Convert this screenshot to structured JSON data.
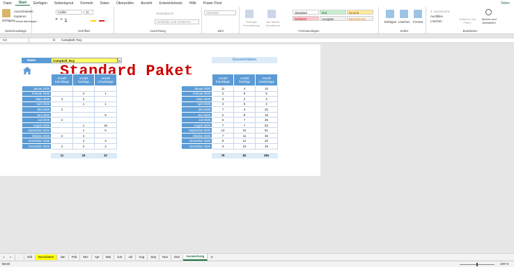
{
  "menu": {
    "tabs": [
      "Datei",
      "Start",
      "Einfügen",
      "Seitenlayout",
      "Formeln",
      "Daten",
      "Überprüfen",
      "Ansicht",
      "Entwicklertools",
      "Hilfe",
      "Power Pivot"
    ],
    "share": "Teilen"
  },
  "ribbon": {
    "clipboard": {
      "paste": "Einfügen",
      "cut": "Ausschneiden",
      "copy": "Kopieren",
      "format_painter": "Format übertragen",
      "group": "Zwischenablage"
    },
    "font": {
      "name": "Calibri",
      "size": "11",
      "group": "Schriftart"
    },
    "alignment": {
      "wrap": "Textumbruch",
      "merge": "Verbinden und zentrieren",
      "group": "Ausrichtung"
    },
    "number": {
      "format": "Standard",
      "group": "Zahl"
    },
    "styles": {
      "conditional": "Bedingte Formatierung",
      "as_table": "Als Tabelle formatieren",
      "standard": "Standard",
      "gut": "Gut",
      "neutral": "Neutral",
      "schlecht": "Schlecht",
      "ausgabe": "Ausgabe",
      "berechnung": "Berechnung",
      "group": "Formatvorlagen"
    },
    "cells": {
      "insert": "Einfügen",
      "delete": "Löschen",
      "format": "Format",
      "group": "Zellen"
    },
    "editing": {
      "autosum": "AutoSumme",
      "fill": "Ausfüllen",
      "clear": "Löschen",
      "sort": "Sortieren und Filtern",
      "find": "Suchen und Auswählen",
      "group": "Bearbeiten"
    }
  },
  "formula_bar": {
    "cell": "C3",
    "fx": "fx",
    "value": "Campbell, Roy"
  },
  "sheet": {
    "name_label": "Name",
    "name_value": "Campbell, Roy",
    "watermark": "Standard Paket",
    "summary_title": "Gesamtdaten",
    "headers": [
      "Anzahl Krankttage",
      "Anzahl Sonstige",
      "Anzahl Urlaubstage"
    ],
    "months": [
      "Januar 2025",
      "Februar 2025",
      "März 2025",
      "April 2025",
      "Mai 2025",
      "Juni 2025",
      "Juli 2025",
      "August 2025",
      "September 2025",
      "Oktober 2025",
      "November 2025",
      "Dezember 2025"
    ],
    "left_rows": [
      [
        "",
        "",
        ""
      ],
      [
        "",
        "4",
        "1"
      ],
      [
        "3",
        "2",
        ""
      ],
      [
        "",
        "1",
        "1"
      ],
      [
        "2",
        "",
        ""
      ],
      [
        "",
        "",
        "5"
      ],
      [
        "2",
        "",
        ""
      ],
      [
        "",
        "1",
        "15"
      ],
      [
        "",
        "1",
        "5"
      ],
      [
        "2",
        "4",
        ""
      ],
      [
        "",
        "4",
        "3"
      ],
      [
        "2",
        "2",
        "2"
      ]
    ],
    "left_totals": [
      "11",
      "19",
      "32"
    ],
    "right_headers": [
      "Anzahl Krankttage",
      "Anzahl Sonstige",
      "Anzahl Urlaubstage"
    ],
    "right_rows": [
      [
        "11",
        "4",
        "10"
      ],
      [
        "2",
        "8",
        "5"
      ],
      [
        "3",
        "2",
        "3"
      ],
      [
        "4",
        "5",
        "4"
      ],
      [
        "7",
        "4",
        "34"
      ],
      [
        "2",
        "8",
        "18"
      ],
      [
        "5",
        "7",
        "35"
      ],
      [
        "7",
        "7",
        "53"
      ],
      [
        "12",
        "10",
        "81"
      ],
      [
        "7",
        "11",
        "36"
      ],
      [
        "9",
        "12",
        "32"
      ],
      [
        "3",
        "10",
        "33"
      ]
    ],
    "right_totals": [
      "78",
      "82",
      "284"
    ]
  },
  "sheet_tabs": [
    "Old",
    "Basisdaten",
    "Jan",
    "Feb",
    "Mrz",
    "Apr",
    "Mai",
    "Jun",
    "Jul",
    "Aug",
    "Sep",
    "Nov",
    "Dez",
    "Auswertung"
  ],
  "status": {
    "mode": "Bereit",
    "zoom": "100 %"
  },
  "colors": {
    "accent": "#5b9bd5",
    "excel_green": "#1f6e43",
    "yellow": "#ffff66",
    "watermark": "#cc0000"
  }
}
